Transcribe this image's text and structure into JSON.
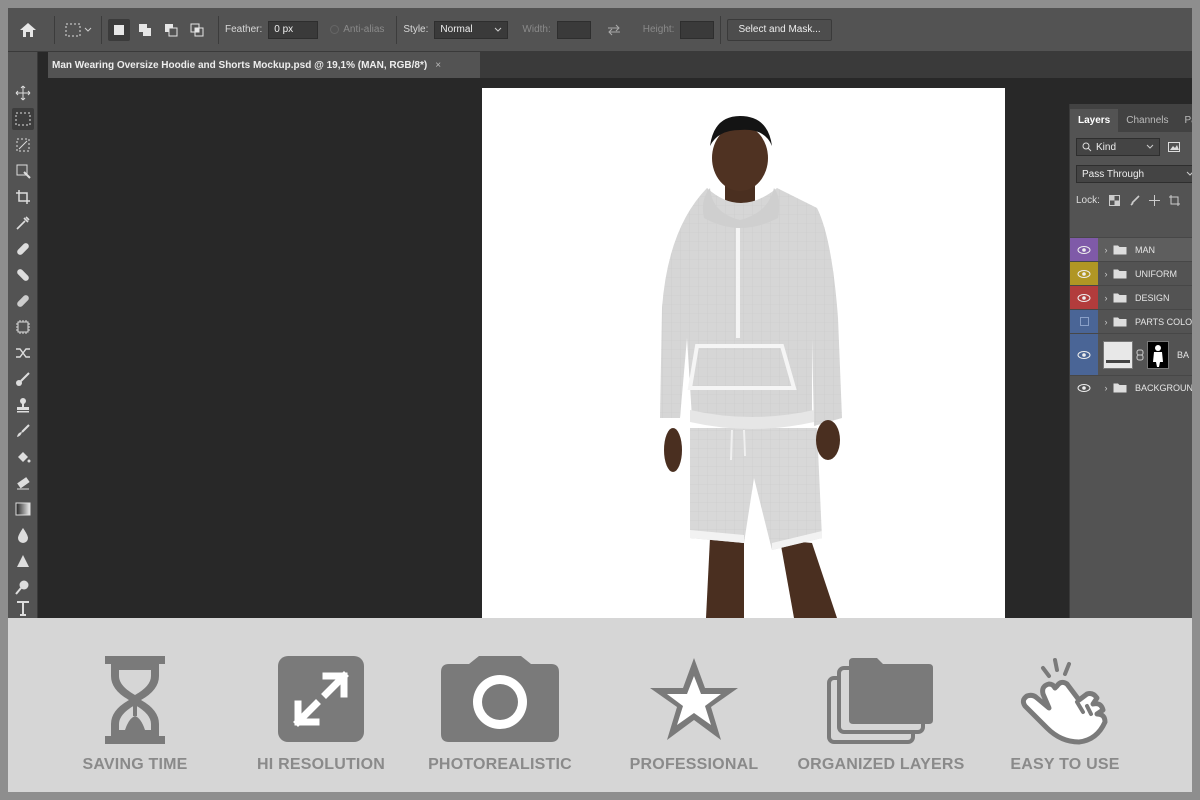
{
  "options_bar": {
    "feather_label": "Feather:",
    "feather_value": "0 px",
    "antialias_label": "Anti-alias",
    "style_label": "Style:",
    "style_value": "Normal",
    "width_label": "Width:",
    "height_label": "Height:",
    "select_mask_label": "Select and Mask..."
  },
  "document": {
    "tab_title": "Man Wearing Oversize Hoodie and Shorts Mockup.psd @ 19,1% (MAN, RGB/8*)",
    "close_glyph": "×"
  },
  "layers_panel": {
    "tabs": [
      "Layers",
      "Channels",
      "Pa"
    ],
    "filter_label": "Kind",
    "blend_mode": "Pass Through",
    "lock_label": "Lock:",
    "layers": [
      {
        "name": "MAN",
        "color": "#7f5aa8",
        "visible": true
      },
      {
        "name": "UNIFORM",
        "color": "#b09624",
        "visible": true
      },
      {
        "name": "DESIGN",
        "color": "#b23c3c",
        "visible": true
      },
      {
        "name": "PARTS COLO",
        "color": "#4a6596",
        "visible": false
      },
      {
        "name": "BA",
        "color": "#4a6596",
        "visible": true
      },
      {
        "name": "BACKGROUN",
        "color": "#535353",
        "visible": true
      }
    ]
  },
  "features": [
    {
      "label": "SAVING TIME",
      "icon": "hourglass-icon"
    },
    {
      "label": "HI RESOLUTION",
      "icon": "expand-icon"
    },
    {
      "label": "PHOTOREALISTIC",
      "icon": "camera-icon"
    },
    {
      "label": "PROFESSIONAL",
      "icon": "star-icon"
    },
    {
      "label": "ORGANIZED LAYERS",
      "icon": "folders-icon"
    },
    {
      "label": "EASY TO USE",
      "icon": "pointer-hand-icon"
    }
  ],
  "colors": {
    "app_bg": "#282828",
    "panel": "#535353",
    "feature_strip": "#d6d6d6",
    "feature_icon": "#7a7a7a"
  }
}
